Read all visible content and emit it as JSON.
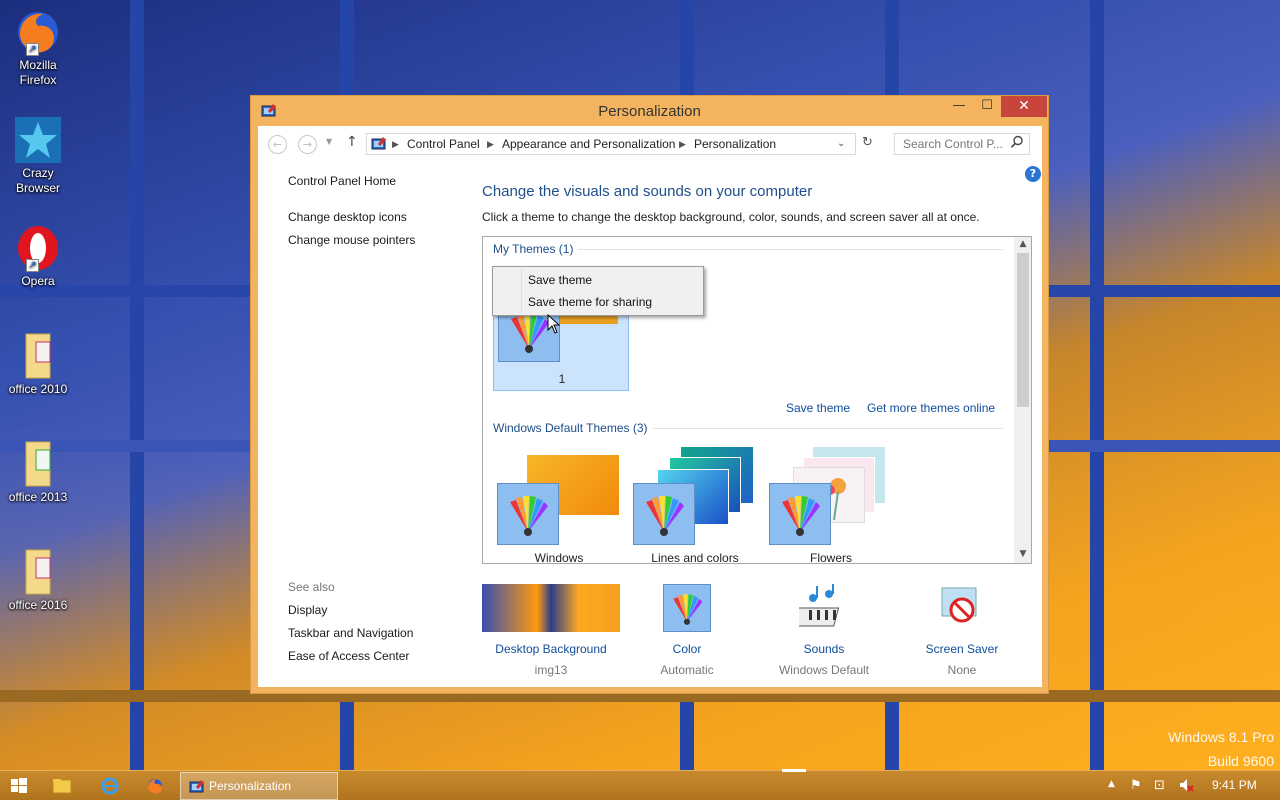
{
  "desktop": {
    "icons": [
      {
        "label_line1": "Mozilla",
        "label_line2": "Firefox",
        "icon": "firefox-icon"
      },
      {
        "label_line1": "Crazy",
        "label_line2": "Browser",
        "icon": "crazy-browser-icon"
      },
      {
        "label_line1": "Opera",
        "label_line2": "",
        "icon": "opera-icon"
      },
      {
        "label_line1": "office 2010",
        "label_line2": "",
        "icon": "folder-icon"
      },
      {
        "label_line1": "office 2013",
        "label_line2": "",
        "icon": "folder-icon"
      },
      {
        "label_line1": "office 2016",
        "label_line2": "",
        "icon": "folder-icon"
      }
    ],
    "watermark": {
      "line1": "Windows 8.1 Pro",
      "line2": "Build 9600"
    }
  },
  "window": {
    "title": "Personalization",
    "controls": {
      "minimize": "—",
      "maximize": "☐",
      "close": "✕"
    },
    "address": {
      "crumbs": [
        "Control Panel",
        "Appearance and Personalization",
        "Personalization"
      ]
    },
    "search": {
      "placeholder": "Search Control P..."
    },
    "left_nav": {
      "home": "Control Panel Home",
      "links": [
        "Change desktop icons",
        "Change mouse pointers"
      ],
      "see_also_title": "See also",
      "see_also": [
        "Display",
        "Taskbar and Navigation",
        "Ease of Access Center"
      ]
    },
    "heading": "Change the visuals and sounds on your computer",
    "subheading": "Click a theme to change the desktop background, color, sounds, and screen saver all at once.",
    "my_themes": {
      "label": "My Themes (1)",
      "items": [
        {
          "name": "1"
        }
      ],
      "save_link": "Save theme",
      "more_link": "Get more themes online"
    },
    "context_menu": {
      "items": [
        "Save theme",
        "Save theme for sharing"
      ]
    },
    "default_themes": {
      "label": "Windows Default Themes (3)",
      "items": [
        {
          "name": "Windows"
        },
        {
          "name": "Lines and colors"
        },
        {
          "name": "Flowers"
        }
      ]
    },
    "bottom": [
      {
        "label": "Desktop Background",
        "sub": "img13"
      },
      {
        "label": "Color",
        "sub": "Automatic"
      },
      {
        "label": "Sounds",
        "sub": "Windows Default"
      },
      {
        "label": "Screen Saver",
        "sub": "None"
      }
    ]
  },
  "taskbar": {
    "active_app": "Personalization",
    "clock": "9:41 PM"
  },
  "colors": {
    "window_frame": "#f4b45f",
    "close_button": "#c7453b",
    "link_blue": "#0f4d9c",
    "heading_blue": "#1e4e8c"
  }
}
